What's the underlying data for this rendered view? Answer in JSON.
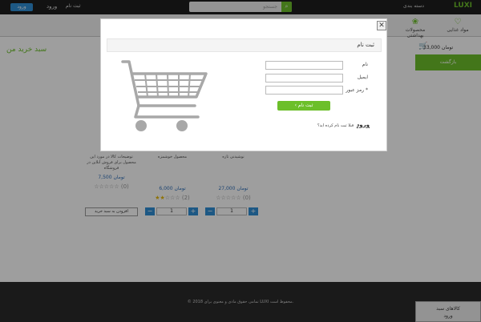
{
  "topbar": {
    "login_button": "ورود",
    "enter_link": "ورود",
    "register_link": "ثبت نام",
    "search_placeholder": "جستجو",
    "search_icon": "search-icon",
    "categories_label": "دسته بندی",
    "logo_text": "LUXI"
  },
  "catbar": {
    "items": [
      {
        "label": "مواد غذایی",
        "icon": "heart-icon"
      },
      {
        "label": "محصولات بهداشتی",
        "icon": "flower-icon"
      }
    ]
  },
  "cart_summary": {
    "amount": "33,000 تومان"
  },
  "return_button": "بازگشت",
  "my_cart_title": "سبد خرید من",
  "products": [
    {
      "desc": "توضیحات کالا در مورد این محصول برای فروش آنلاین در فروشگاه",
      "price": "7,500 تومان",
      "rating_count": "(0)",
      "stars": 0
    },
    {
      "desc": "محصول خوشمزه",
      "price": "6,000 تومان",
      "rating_count": "(2)",
      "stars": 2
    },
    {
      "desc": "نوشیدنی تازه",
      "price": "27,000 تومان",
      "rating_count": "(0)",
      "stars": 0
    }
  ],
  "qty_value": "1",
  "add_to_cart": "افزودن به سبد خرید",
  "footer": {
    "copyright": "© 2018 تمامی حقوق مادی و معنوی برای LUXI محفوظ است.",
    "checkout_line1": "کالاهای سبد",
    "checkout_line2": "ورود"
  },
  "modal": {
    "title": "ثبت نام",
    "close_glyph": "✕",
    "fields": [
      {
        "label": "نام",
        "value": ""
      },
      {
        "label": "ایمیل",
        "value": ""
      },
      {
        "label": "رمز عبور *",
        "value": ""
      }
    ],
    "submit_label": "ثبت نام",
    "already_text": "قبلا ثبت نام کرده اید؟",
    "already_link": "ورود"
  },
  "colors": {
    "accent": "#6cbf2a",
    "primary": "#2f8fd6",
    "dark": "#1e1e1e"
  }
}
